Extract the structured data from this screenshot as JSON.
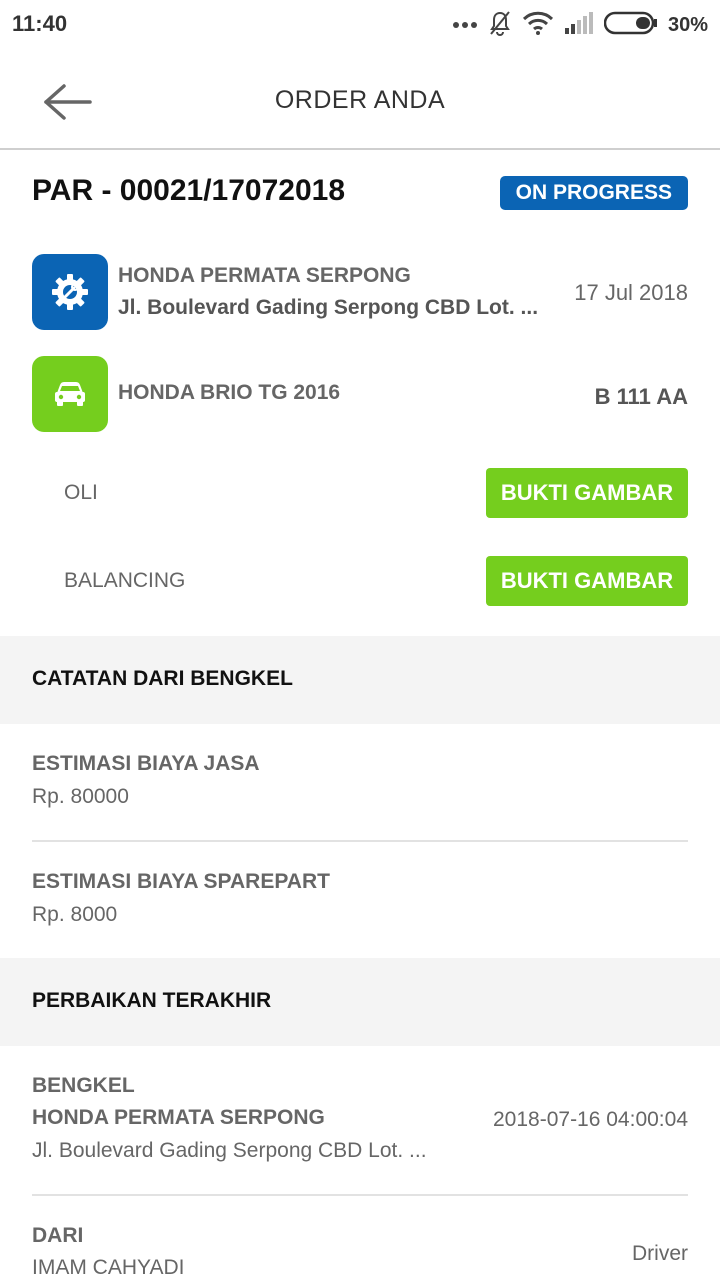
{
  "status_bar": {
    "time": "11:40",
    "battery": "30%",
    "icons": [
      "more-dots-icon",
      "bell-off-icon",
      "wifi-icon",
      "signal-icon",
      "battery-icon"
    ]
  },
  "app_bar": {
    "title": "ORDER ANDA",
    "back_icon": "arrow-left-icon"
  },
  "order": {
    "number": "PAR - 00021/17072018",
    "status": "ON PROGRESS",
    "status_color": "#0b64b4",
    "workshop_icon": "gear-wrench-icon",
    "workshop_name": "HONDA PERMATA SERPONG",
    "workshop_address": "Jl. Boulevard Gading Serpong CBD Lot. ...",
    "date": "17 Jul 2018",
    "vehicle_icon": "car-icon",
    "vehicle": "HONDA BRIO TG 2016",
    "plate": "B 111 AA",
    "services": [
      {
        "name": "OLI",
        "button": "BUKTI GAMBAR"
      },
      {
        "name": "BALANCING",
        "button": "BUKTI GAMBAR"
      }
    ],
    "accent_green": "#75ce1e"
  },
  "notes": {
    "title": "CATATAN DARI BENGKEL",
    "service_cost_label": "ESTIMASI BIAYA JASA",
    "service_cost": "Rp. 80000",
    "sparepart_cost_label": "ESTIMASI BIAYA SPAREPART",
    "sparepart_cost": "Rp. 8000"
  },
  "last_repair": {
    "title": "PERBAIKAN TERAKHIR",
    "workshop_label": "BENGKEL",
    "workshop_name": "HONDA PERMATA SERPONG",
    "workshop_address": "Jl. Boulevard Gading Serpong CBD Lot. ...",
    "datetime": "2018-07-16 04:00:04",
    "from_label": "DARI",
    "from_name": "IMAM CAHYADI",
    "from_role": "Driver"
  }
}
